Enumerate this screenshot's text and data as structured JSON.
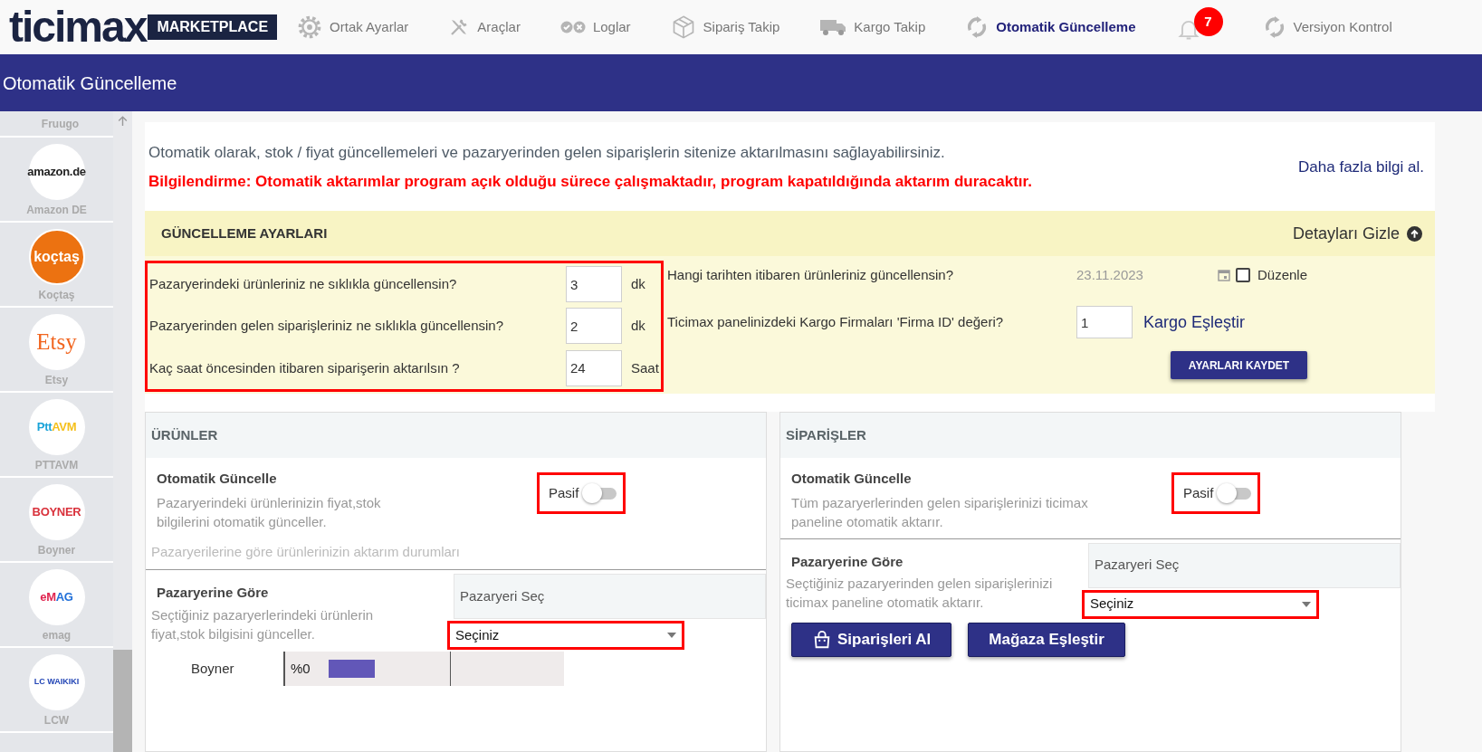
{
  "nav": {
    "logo": "ticimax",
    "logo_badge": "MARKETPLACE",
    "items": [
      {
        "kind": "gear",
        "label": "Ortak Ayarlar",
        "selected": false
      },
      {
        "kind": "tools",
        "label": "Araçlar",
        "selected": false
      },
      {
        "kind": "checks",
        "label": "Loglar",
        "selected": false
      },
      {
        "kind": "box",
        "label": "Sipariş Takip",
        "selected": false
      },
      {
        "kind": "truck",
        "label": "Kargo Takip",
        "selected": false
      },
      {
        "kind": "sync",
        "label": "Otomatik Güncelleme",
        "selected": true
      },
      {
        "kind": "bell",
        "badge": "7",
        "selected": false
      },
      {
        "kind": "sync",
        "label": "Versiyon Kontrol",
        "selected": false
      }
    ]
  },
  "page_title": "Otomatik Güncelleme",
  "sidebar": {
    "items": [
      {
        "kind": "cut",
        "name": "Fruugo"
      },
      {
        "kind": "plain",
        "name": "Amazon DE",
        "logo": [
          {
            "text": "amazon.de",
            "color": "#222222"
          }
        ]
      },
      {
        "kind": "filled",
        "name": "Koçtaş",
        "color": "#ec7211",
        "logo": [
          {
            "text": "koçtaş",
            "color": "#ffffff"
          }
        ]
      },
      {
        "kind": "serif",
        "name": "Etsy",
        "logo": [
          {
            "text": "Etsy",
            "color": "#f1641e"
          }
        ]
      },
      {
        "kind": "plain",
        "name": "PTTAVM",
        "logo": [
          {
            "text": "Ptt",
            "color": "#1aa3d8"
          },
          {
            "text": "AVM",
            "color": "#f5c01c"
          }
        ]
      },
      {
        "kind": "plain",
        "name": "Boyner",
        "logo": [
          {
            "text": "BOYNER",
            "color": "#d9323c"
          }
        ]
      },
      {
        "kind": "plain",
        "name": "emag",
        "logo": [
          {
            "text": "eM",
            "color": "#e0234e"
          },
          {
            "text": "AG",
            "color": "#1e6ed8"
          }
        ]
      },
      {
        "kind": "small",
        "name": "LCW",
        "logo": [
          {
            "text": "LC WAIKIKI",
            "color": "#2144b5"
          }
        ]
      }
    ]
  },
  "intro": {
    "text": "Otomatik olarak, stok / fiyat güncellemeleri ve pazaryerinden gelen siparişlerin sitenize aktarılmasını sağlayabilirsiniz.",
    "warning": "Bilgilendirme: Otomatik aktarımlar program açık olduğu sürece çalışmaktadır, program kapatıldığında aktarım duracaktır.",
    "more_link": "Daha fazla bilgi al."
  },
  "settings": {
    "title": "GÜNCELLEME AYARLARI",
    "toggle_label": "Detayları Gizle",
    "highlighted": true,
    "rows": [
      {
        "label": "Pazaryerindeki ürünleriniz ne sıklıkla güncellensin?",
        "value": "3",
        "unit": "dk"
      },
      {
        "label": "Pazaryerinden gelen siparişleriniz ne sıklıkla güncellensin?",
        "value": "2",
        "unit": "dk"
      },
      {
        "label": "Kaç saat öncesinden itibaren siparişerin aktarılsın ?",
        "value": "24",
        "unit": "Saat"
      }
    ],
    "date_row": {
      "label": "Hangi tarihten itibaren ürünleriniz güncellensin?",
      "value": "23.11.2023",
      "disabled": true,
      "edit_label": "Düzenle",
      "checked": false
    },
    "cargo_row": {
      "label": "Ticimax panelinizdeki Kargo Firmaları 'Firma ID' değeri?",
      "value": "1",
      "link": "Kargo Eşleştir"
    },
    "save_button": "AYARLARI KAYDET"
  },
  "panels": [
    {
      "title": "ÜRÜNLER",
      "toggle_title": "Otomatik Güncelle",
      "toggle_desc": "Pazaryerindeki ürünlerinizin fiyat,stok bilgilerini otomatik günceller.",
      "toggle_label": "Pasif",
      "on": false,
      "highlighted": true,
      "note": "Pazaryerilerine göre ürünlerinizin aktarım durumları",
      "market_title": "Pazaryerine Göre",
      "market_desc": "Seçtiğiniz pazaryerlerindeki ürünlerin fiyat,stok bilgisini günceller.",
      "select_header": "Pazaryeri Seç",
      "select_value": "Seçiniz",
      "select_highlighted": true,
      "status_rows": [
        {
          "name": "Boyner",
          "percent": "%0"
        }
      ]
    },
    {
      "title": "SİPARİŞLER",
      "toggle_title": "Otomatik Güncelle",
      "toggle_desc": "Tüm pazaryerlerinden gelen siparişlerinizi ticimax paneline otomatik aktarır.",
      "toggle_label": "Pasif",
      "on": false,
      "highlighted": true,
      "market_title": "Pazaryerine Göre",
      "market_desc": "Seçtiğiniz pazaryerinden gelen siparişlerinizi ticimax paneline otomatik aktarır.",
      "select_header": "Pazaryeri Seç",
      "select_value": "Seçiniz",
      "select_highlighted": true,
      "buttons": [
        {
          "kind": "bag",
          "label": "Siparişleri Al"
        },
        {
          "kind": "plain",
          "label": "Mağaza Eşleştir"
        }
      ]
    }
  ]
}
